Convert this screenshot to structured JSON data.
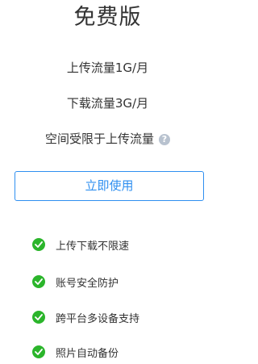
{
  "plan": {
    "title": "免费版",
    "quotas": [
      "上传流量1G/月",
      "下载流量3G/月",
      "空间受限于上传流量"
    ],
    "help_glyph": "?",
    "cta_label": "立即使用"
  },
  "features": [
    {
      "label": "上传下载不限速",
      "icon": "check-circle-icon"
    },
    {
      "label": "账号安全防护",
      "icon": "check-circle-icon"
    },
    {
      "label": "跨平台多设备支持",
      "icon": "check-circle-icon"
    },
    {
      "label": "照片自动备份",
      "icon": "check-circle-icon"
    }
  ],
  "colors": {
    "accent": "#2f8ff0",
    "check": "#2bb52b",
    "help_icon": "#b8c2cf",
    "text": "#333333"
  }
}
